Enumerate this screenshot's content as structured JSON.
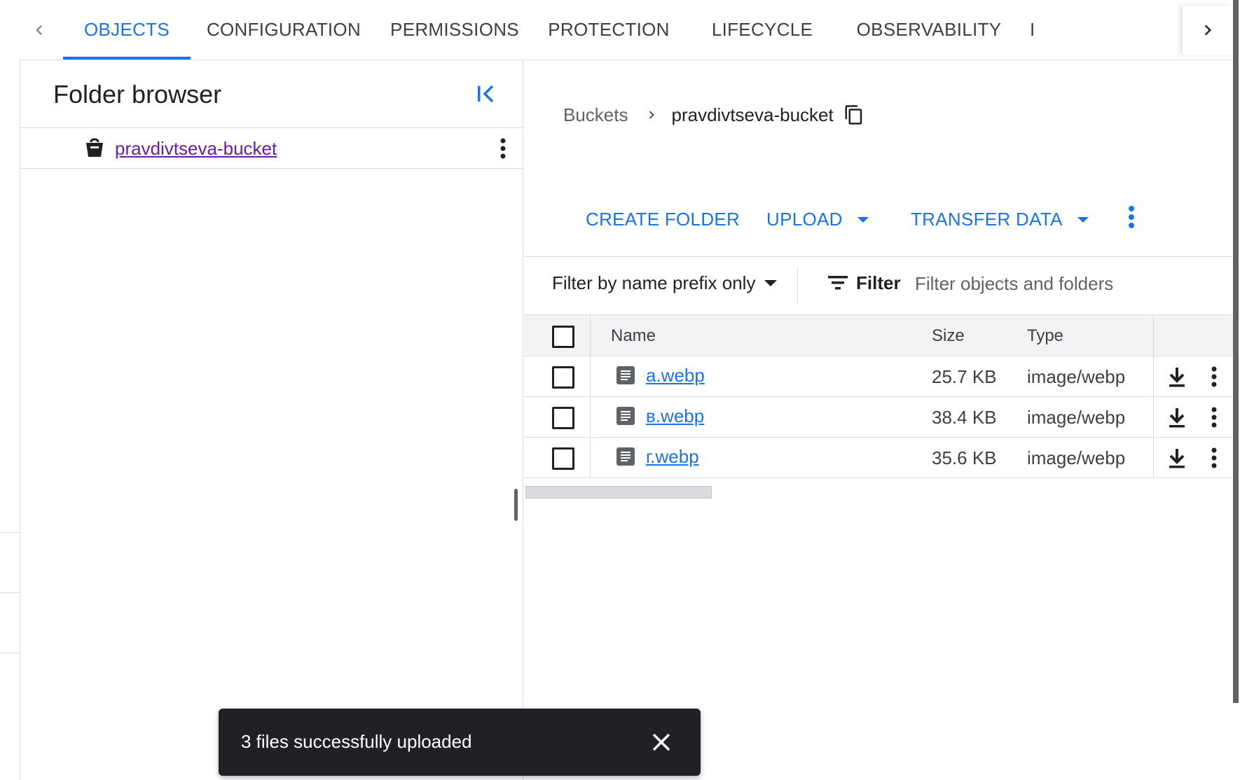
{
  "tabs": [
    {
      "label": "OBJECTS",
      "active": true
    },
    {
      "label": "CONFIGURATION",
      "active": false
    },
    {
      "label": "PERMISSIONS",
      "active": false
    },
    {
      "label": "PROTECTION",
      "active": false
    },
    {
      "label": "LIFECYCLE",
      "active": false
    },
    {
      "label": "OBSERVABILITY",
      "active": false
    },
    {
      "label": "I",
      "active": false
    }
  ],
  "folder_browser": {
    "title": "Folder browser",
    "bucket_name": "pravdivtseva-bucket"
  },
  "breadcrumb": {
    "root": "Buckets",
    "current": "pravdivtseva-bucket"
  },
  "actions": {
    "create_folder": "CREATE FOLDER",
    "upload": "UPLOAD",
    "transfer_data": "TRANSFER DATA"
  },
  "filter": {
    "mode": "Filter by name prefix only",
    "label": "Filter",
    "placeholder": "Filter objects and folders"
  },
  "table": {
    "headers": {
      "name": "Name",
      "size": "Size",
      "type": "Type"
    },
    "rows": [
      {
        "name": "а.webp",
        "size": "25.7 KB",
        "type": "image/webp"
      },
      {
        "name": "в.webp",
        "size": "38.4 KB",
        "type": "image/webp"
      },
      {
        "name": "г.webp",
        "size": "35.6 KB",
        "type": "image/webp"
      }
    ]
  },
  "snackbar": {
    "message": "3 files successfully uploaded"
  },
  "colors": {
    "accent": "#1a73e8",
    "visited_link": "#681da8",
    "snackbar_bg": "#202124"
  }
}
